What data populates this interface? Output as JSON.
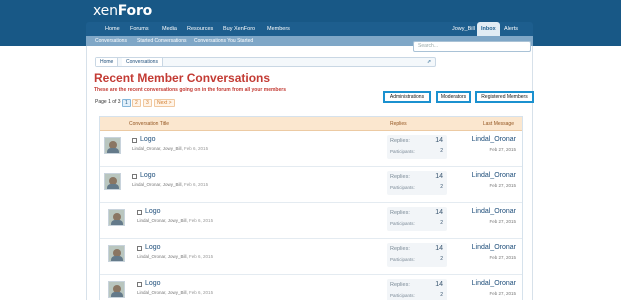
{
  "header": {
    "logo_prefix": "xen",
    "logo_suffix": "Foro",
    "nav": [
      {
        "label": "Home"
      },
      {
        "label": "Forums"
      },
      {
        "label": "Media"
      },
      {
        "label": "Resources"
      },
      {
        "label": "Buy XenForo"
      },
      {
        "label": "Members"
      }
    ],
    "user": "Jowy_Bill",
    "inbox": "Inbox",
    "alerts": "Alerts"
  },
  "subnav": [
    {
      "label": "Conversations"
    },
    {
      "label": "Started Conversations"
    },
    {
      "label": "Conversations You Started"
    }
  ],
  "search": {
    "placeholder": "Search..."
  },
  "breadcrumb": [
    {
      "label": "Home"
    },
    {
      "label": "Conversations"
    }
  ],
  "page": {
    "title": "Recent Member Conversations",
    "subtitle": "These are the recent conversations going on in the forum from all your members"
  },
  "filter_buttons": [
    {
      "label": "Administrations"
    },
    {
      "label": "Moderators"
    },
    {
      "label": "Registered Members"
    }
  ],
  "pager": {
    "label": "Page 1 of 3",
    "pages": [
      "1",
      "2",
      "3"
    ],
    "next": "Next >"
  },
  "list": {
    "headers": {
      "title": "Conversation Title",
      "replies": "Replies",
      "last_message": "Last Message"
    },
    "stats_labels": {
      "replies": "Replies:",
      "participants": "Participants:"
    },
    "rows": [
      {
        "title": "Logo",
        "participants_text": "Lindal_Oronar, Jowy_Bill,",
        "started": "Feb 6, 2015",
        "replies": "14",
        "participants": "2",
        "last_user": "Lindal_Oronar",
        "last_date": "Feb 27, 2015"
      },
      {
        "title": "Logo",
        "participants_text": "Lindal_Oronar, Jowy_Bill,",
        "started": "Feb 6, 2015",
        "replies": "14",
        "participants": "2",
        "last_user": "Lindal_Oronar",
        "last_date": "Feb 27, 2015"
      },
      {
        "title": "Logo",
        "participants_text": "Lindal_Oronar, Jowy_Bill,",
        "started": "Feb 6, 2015",
        "replies": "14",
        "participants": "2",
        "last_user": "Lindal_Oronar",
        "last_date": "Feb 27, 2015"
      },
      {
        "title": "Logo",
        "participants_text": "Lindal_Oronar, Jowy_Bill,",
        "started": "Feb 6, 2015",
        "replies": "14",
        "participants": "2",
        "last_user": "Lindal_Oronar",
        "last_date": "Feb 27, 2015"
      },
      {
        "title": "Logo",
        "participants_text": "Lindal_Oronar, Jowy_Bill,",
        "started": "Feb 6, 2015",
        "replies": "14",
        "participants": "2",
        "last_user": "Lindal_Oronar",
        "last_date": "Feb 27, 2015"
      }
    ]
  },
  "colors": {
    "header_bg": "#185886",
    "title_red": "#c33b34",
    "button_border": "#1b91cf",
    "list_header_bg": "#fbe7cf"
  }
}
